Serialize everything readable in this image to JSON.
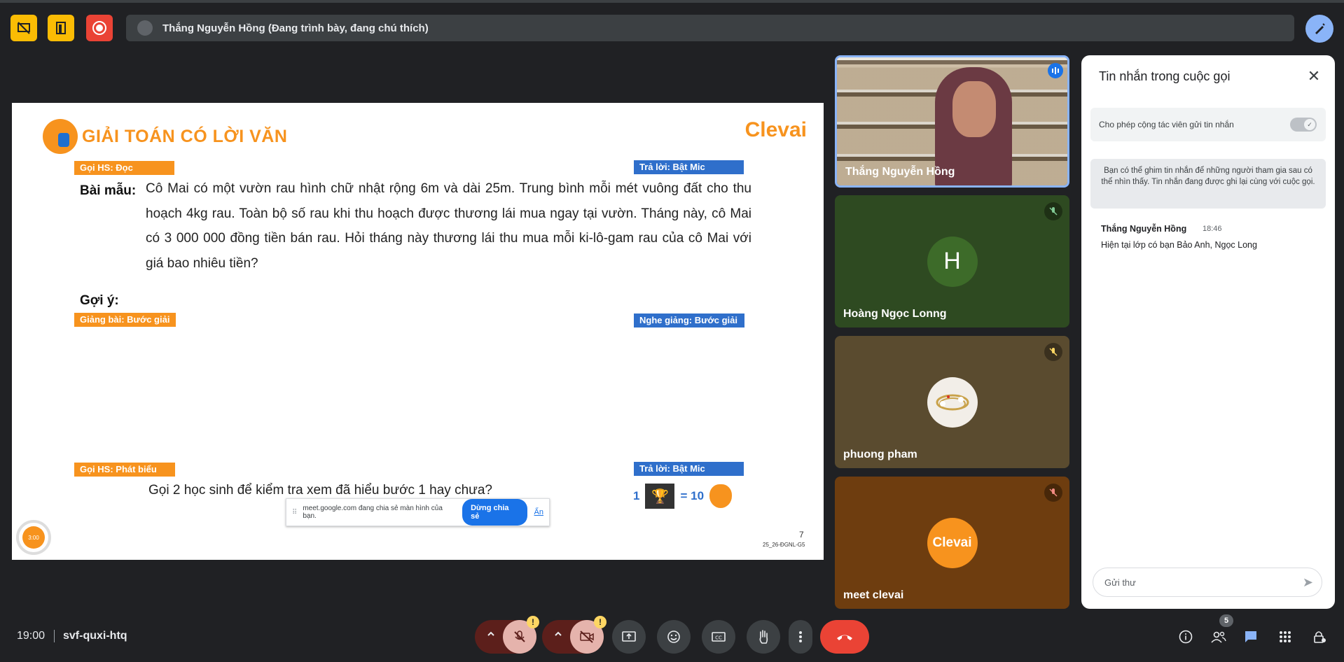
{
  "topbar": {
    "presenter_text": "Thắng Nguyễn Hồng (Đang trình bày, đang chú thích)",
    "buttons": [
      {
        "icon": "stop-presenting-icon",
        "color": "#fbbc04"
      },
      {
        "icon": "door-icon",
        "color": "#fbbc04"
      },
      {
        "icon": "record-icon",
        "color": "#ea4335"
      }
    ]
  },
  "slide": {
    "title": "GIẢI TOÁN CÓ LỜI VĂN",
    "brand": "Clevai",
    "tags": {
      "goi_doc": "Gọi HS: Đọc",
      "tra_loi_1": "Trả lời: Bật Mic",
      "giang_bai": "Giảng bài: Bước giải",
      "nghe_giang": "Nghe giảng: Bước giải",
      "goi_phat_bieu": "Gọi HS: Phát biểu",
      "tra_loi_2": "Trả lời: Bật Mic"
    },
    "bai_mau_label": "Bài mẫu:",
    "problem_text": "Cô Mai có một vườn rau hình chữ nhật rộng 6m và dài 25m. Trung bình mỗi mét vuông đất cho thu hoạch 4kg rau. Toàn bộ số rau khi thu hoạch được thương lái mua ngay tại vườn. Tháng này, cô Mai có 3 000 000 đồng tiền bán rau. Hỏi tháng này thương lái thu mua mỗi ki-lô-gam rau của cô Mai với giá bao nhiêu tiền?",
    "goi_y_label": "Gợi ý:",
    "question_text": "Gọi 2 học sinh để kiểm tra xem đã hiểu bước 1 hay chưa?",
    "reward_left": "1",
    "reward_right": "= 10",
    "timer": "3:00",
    "page_number": "7",
    "code": "25_26-ĐGNL-G5"
  },
  "share_popup": {
    "text": "meet.google.com đang chia sẻ màn hình của bạn.",
    "stop_label": "Dừng chia sẻ",
    "hide_label": "Ẩn"
  },
  "tiles": [
    {
      "name": "Thắng Nguyễn Hồng",
      "speaking": true
    },
    {
      "name": "Hoàng Ngọc Lonng",
      "avatar_letter": "H",
      "muted": true
    },
    {
      "name": "phuong pham",
      "muted": true
    },
    {
      "name": "meet clevai",
      "avatar_text": "Clevai",
      "muted": true
    }
  ],
  "chat": {
    "title": "Tin nhắn trong cuộc gọi",
    "toggle_label": "Cho phép cộng tác viên gửi tin nhắn",
    "toggle_on": true,
    "info": "Bạn có thể ghim tin nhắn để những người tham gia sau có thể nhìn thấy. Tin nhắn đang được ghi lại cùng với cuộc gọi.",
    "messages": [
      {
        "author": "Thắng Nguyễn Hồng",
        "time": "18:46",
        "text": "Hiện tại lớp có bạn Bảo Anh, Ngọc Long"
      }
    ],
    "input_placeholder": "Gửi thư"
  },
  "bottombar": {
    "time": "19:00",
    "meeting_code": "svf-quxi-htq",
    "warning_badge": "!",
    "people_count": "5",
    "accent": "#8ab4f8",
    "leave_color": "#ea4335"
  }
}
